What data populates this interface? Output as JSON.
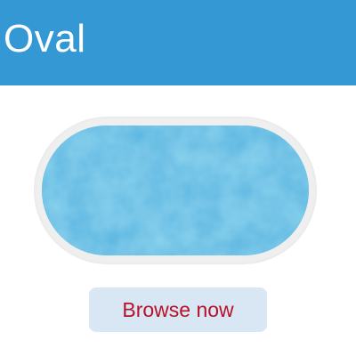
{
  "header": {
    "title": "Oval",
    "background_color": "#3498d4"
  },
  "pool": {
    "shape": "oval",
    "rim_color": "#efefef",
    "water_color": "#5ab8e2"
  },
  "action": {
    "browse_label": "Browse now",
    "text_color": "#b5122a",
    "background_color": "#d9e6f3"
  }
}
